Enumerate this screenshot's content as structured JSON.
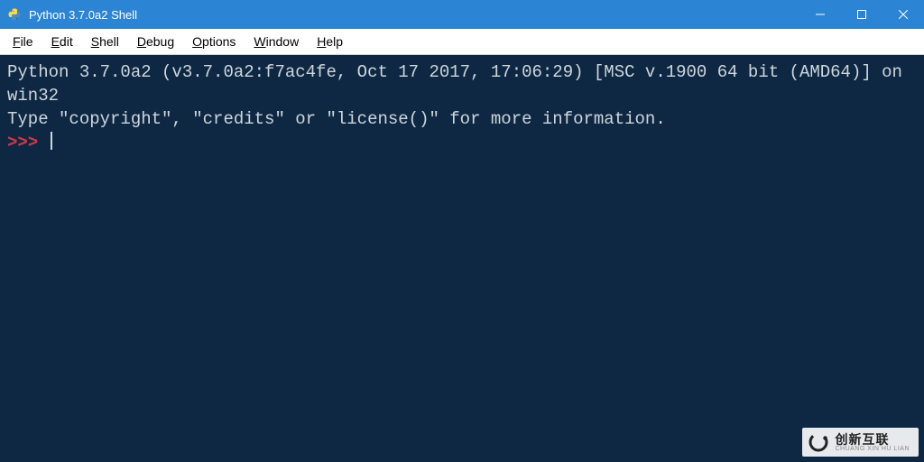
{
  "titlebar": {
    "title": "Python 3.7.0a2 Shell"
  },
  "menu": {
    "file": {
      "u": "F",
      "rest": "ile"
    },
    "edit": {
      "u": "E",
      "rest": "dit"
    },
    "shell": {
      "u": "S",
      "rest": "hell"
    },
    "debug": {
      "u": "D",
      "rest": "ebug"
    },
    "options": {
      "u": "O",
      "rest": "ptions"
    },
    "window": {
      "u": "W",
      "rest": "indow"
    },
    "help": {
      "u": "H",
      "rest": "elp"
    }
  },
  "terminal": {
    "line1": "Python 3.7.0a2 (v3.7.0a2:f7ac4fe, Oct 17 2017, 17:06:29) [MSC v.1900 64 bit (AMD64)] on win32",
    "line2": "Type \"copyright\", \"credits\" or \"license()\" for more information.",
    "prompt": ">>> "
  },
  "watermark": {
    "main": "创新互联",
    "sub": "CHUANG XIN HU LIAN"
  }
}
